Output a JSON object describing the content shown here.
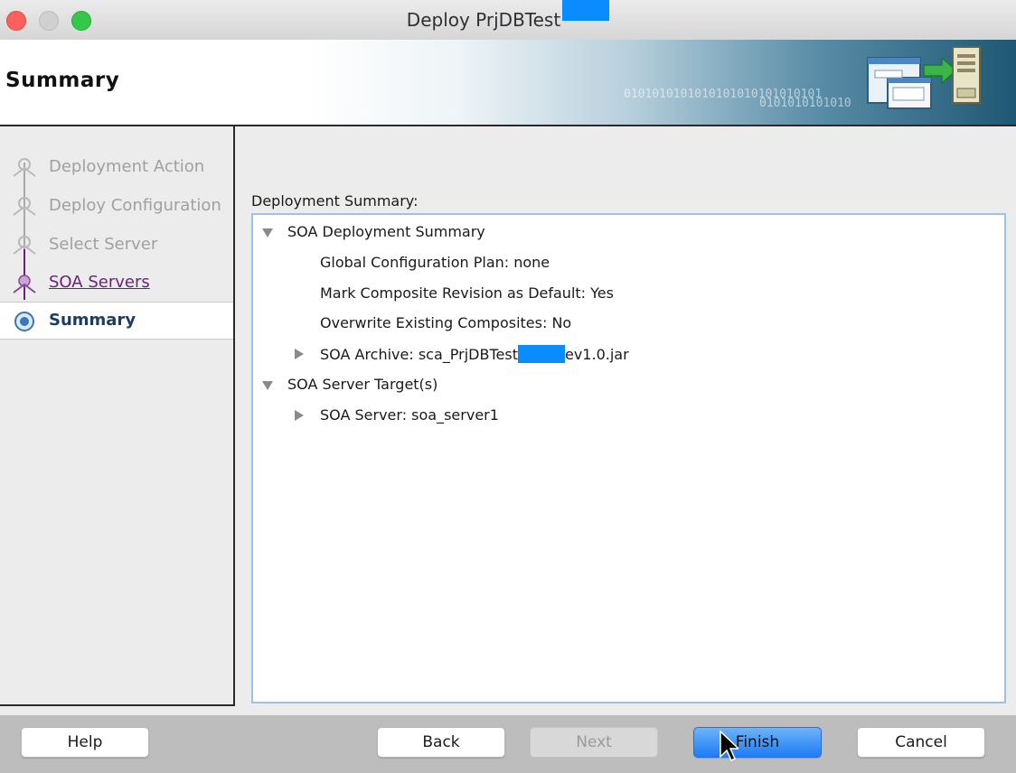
{
  "window": {
    "title": "Deploy PrjDBTest"
  },
  "banner": {
    "page_title": "Summary",
    "binary_text_1": "0101010101010101010101010101",
    "binary_text_2": "0101010101010"
  },
  "nav": {
    "items": [
      {
        "label": "Deployment Action",
        "state": "disabled"
      },
      {
        "label": "Deploy Configuration",
        "state": "disabled"
      },
      {
        "label": "Select Server",
        "state": "disabled"
      },
      {
        "label": "SOA Servers",
        "state": "visited"
      },
      {
        "label": "Summary",
        "state": "current"
      }
    ]
  },
  "main": {
    "section_label": "Deployment Summary:",
    "tree": {
      "deployment_summary": "SOA Deployment Summary",
      "global_config_plan": "Global Configuration Plan: none",
      "mark_default": "Mark Composite Revision as Default: Yes",
      "overwrite": "Overwrite Existing Composites: No",
      "archive_prefix": "SOA Archive: sca_PrjDBTest",
      "archive_suffix": "ev1.0.jar",
      "server_targets": "SOA Server Target(s)",
      "soa_server": "SOA Server: soa_server1"
    }
  },
  "buttons": {
    "help": "Help",
    "back": "Back",
    "next": "Next",
    "finish": "Finish",
    "cancel": "Cancel"
  },
  "colors": {
    "redaction": "#0a8cff",
    "default_button": "#1f7cf5",
    "visited_link": "#6a2477",
    "current_step": "#1c3c60"
  }
}
